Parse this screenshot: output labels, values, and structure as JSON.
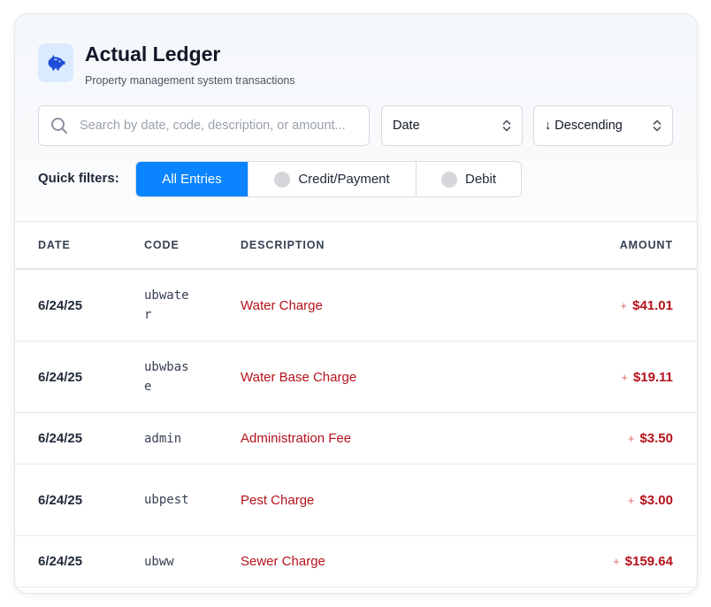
{
  "header": {
    "title": "Actual Ledger",
    "subtitle": "Property management system transactions",
    "logo_icon": "piggy-bank-icon"
  },
  "search": {
    "placeholder": "Search by date, code, description, or amount...",
    "value": ""
  },
  "sort": {
    "field": "Date",
    "order": "↓ Descending"
  },
  "quick_filters": {
    "label": "Quick filters:",
    "options": [
      {
        "label": "All Entries",
        "active": true
      },
      {
        "label": "Credit/Payment",
        "active": false
      },
      {
        "label": "Debit",
        "active": false
      }
    ]
  },
  "table": {
    "columns": [
      "DATE",
      "CODE",
      "DESCRIPTION",
      "AMOUNT"
    ],
    "rows": [
      {
        "date": "6/24/25",
        "code": "ubwater",
        "description": "Water Charge",
        "sign": "+",
        "amount": "$41.01"
      },
      {
        "date": "6/24/25",
        "code": "ubwbase",
        "description": "Water Base Charge",
        "sign": "+",
        "amount": "$19.11"
      },
      {
        "date": "6/24/25",
        "code": "admin",
        "description": "Administration Fee",
        "sign": "+",
        "amount": "$3.50"
      },
      {
        "date": "6/24/25",
        "code": "ubpest",
        "description": "Pest Charge",
        "sign": "+",
        "amount": "$3.00"
      },
      {
        "date": "6/24/25",
        "code": "ubww",
        "description": "Sewer Charge",
        "sign": "+",
        "amount": "$159.64"
      }
    ]
  },
  "colors": {
    "accent": "#0a84ff",
    "charge": "#b5121b",
    "logo_bg": "#dbeafe"
  }
}
